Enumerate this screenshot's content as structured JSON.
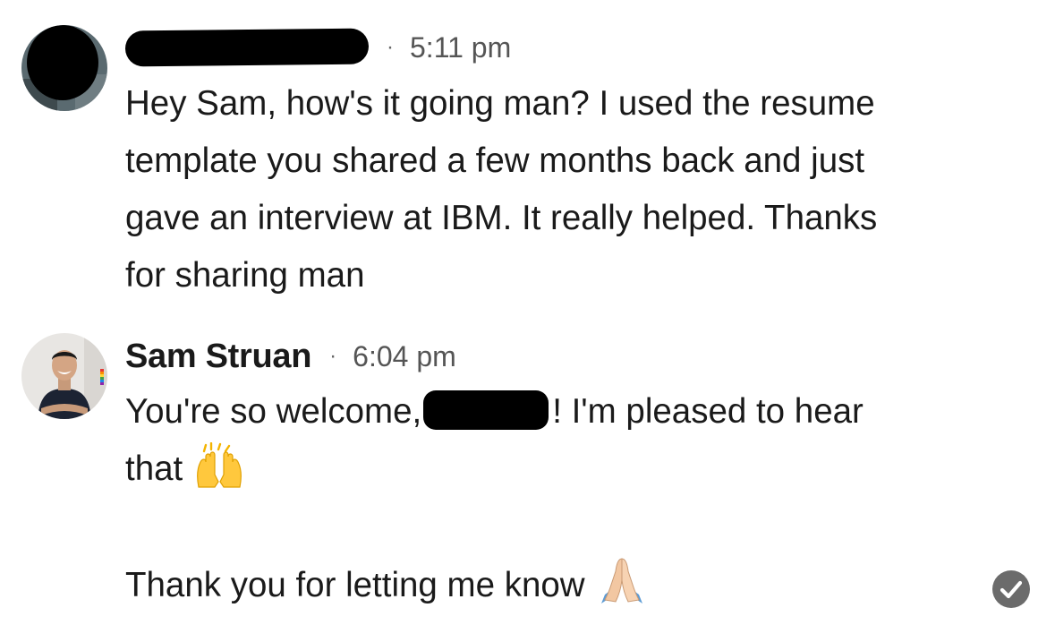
{
  "messages": [
    {
      "sender": "",
      "sender_redacted": true,
      "separator": "·",
      "time": "5:11 pm",
      "lines": [
        "Hey Sam, how's it going man? I used the resume",
        "template you shared a few months back and just",
        "gave an interview at IBM. It really helped. Thanks",
        "for sharing man"
      ]
    },
    {
      "sender": "Sam Struan",
      "separator": "·",
      "time": "6:04 pm",
      "line1_before": "You're so welcome,",
      "line1_after": "! I'm pleased to hear",
      "line2": "that",
      "line2_emoji": "raising-hands-emoji",
      "line4": "Thank you for letting me know",
      "line4_emoji": "folded-hands-emoji"
    }
  ],
  "status": {
    "icon": "read-check-icon",
    "color": "#6b6b6b"
  },
  "colors": {
    "text": "#1a1a1a",
    "timestamp": "#555555",
    "redaction": "#000000"
  }
}
